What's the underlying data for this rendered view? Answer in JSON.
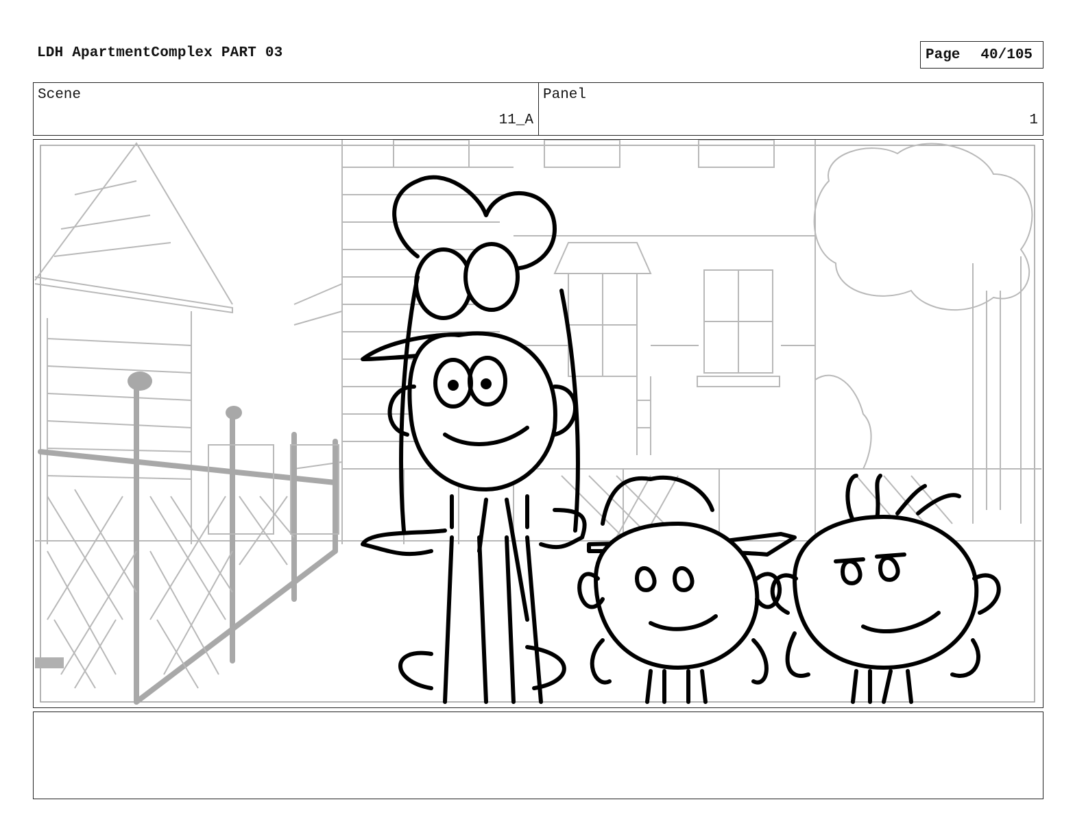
{
  "header": {
    "title": "LDH ApartmentComplex PART 03",
    "page_label": "Page",
    "page_value": "40/105"
  },
  "meta": {
    "scene_label": "Scene",
    "scene_value": "11_A",
    "panel_label": "Panel",
    "panel_value": "1"
  },
  "notes": {
    "text": ""
  }
}
